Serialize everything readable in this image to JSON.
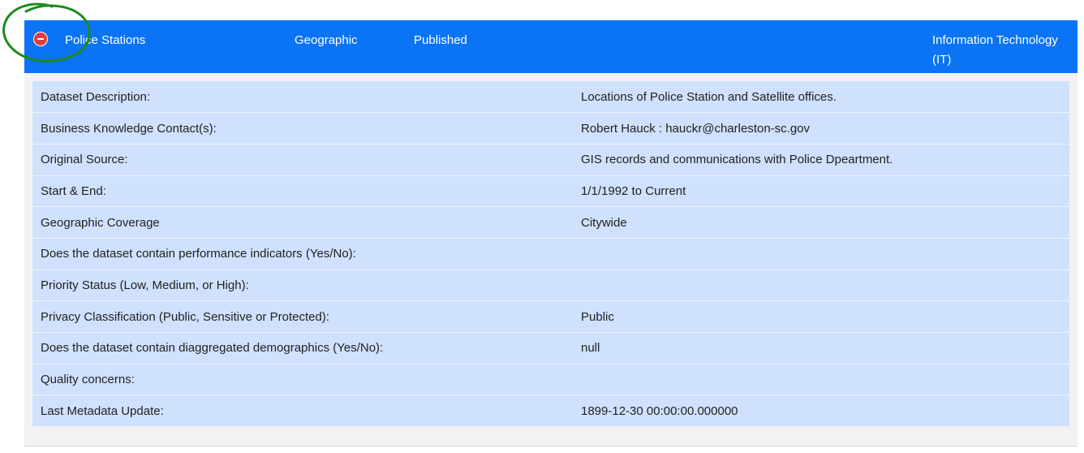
{
  "header": {
    "name": "Police Stations",
    "type": "Geographic",
    "status": "Published",
    "department": "Information Technology (IT)"
  },
  "details": [
    {
      "label": "Dataset Description:",
      "value": "Locations of Police Station and Satellite offices."
    },
    {
      "label": "Business Knowledge Contact(s):",
      "value": "Robert Hauck : hauckr@charleston-sc.gov"
    },
    {
      "label": "Original Source:",
      "value": "GIS records and communications with Police Dpeartment."
    },
    {
      "label": "Start & End:",
      "value": "1/1/1992 to Current"
    },
    {
      "label": "Geographic Coverage",
      "value": "Citywide"
    },
    {
      "label": "Does the dataset contain performance indicators (Yes/No):",
      "value": ""
    },
    {
      "label": "Priority Status (Low, Medium, or High):",
      "value": ""
    },
    {
      "label": "Privacy Classification (Public, Sensitive or Protected):",
      "value": "Public"
    },
    {
      "label": "Does the dataset contain diaggregated demographics (Yes/No):",
      "value": "null"
    },
    {
      "label": "Quality concerns:",
      "value": ""
    },
    {
      "label": "Last Metadata Update:",
      "value": "1899-12-30 00:00:00.000000"
    }
  ],
  "colors": {
    "header_bg": "#0a74f5",
    "row_bg": "#cfe1fd",
    "collapse_icon": "#e23d3d",
    "annotation": "#1e8a1e"
  },
  "icons": {
    "collapse": "minus-circle-icon"
  }
}
